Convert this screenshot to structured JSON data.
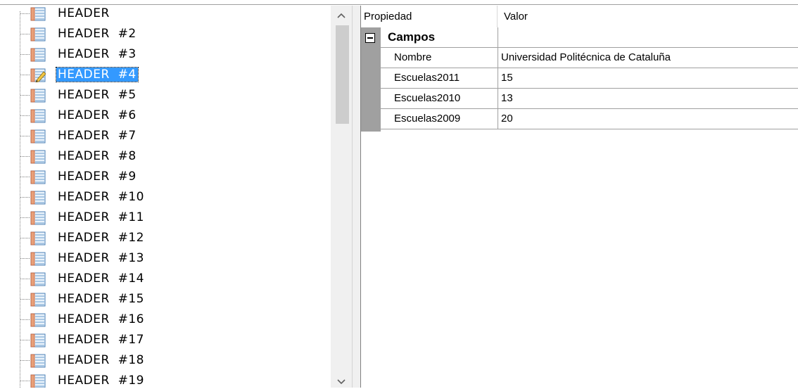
{
  "tree": {
    "selected_index": 3,
    "items": [
      {
        "label": "HEADER",
        "icon": "table-icon"
      },
      {
        "label": "HEADER  #2",
        "icon": "table-icon"
      },
      {
        "label": "HEADER  #3",
        "icon": "table-icon"
      },
      {
        "label": "HEADER  #4",
        "icon": "table-edit-icon"
      },
      {
        "label": "HEADER  #5",
        "icon": "table-icon"
      },
      {
        "label": "HEADER  #6",
        "icon": "table-icon"
      },
      {
        "label": "HEADER  #7",
        "icon": "table-icon"
      },
      {
        "label": "HEADER  #8",
        "icon": "table-icon"
      },
      {
        "label": "HEADER  #9",
        "icon": "table-icon"
      },
      {
        "label": "HEADER  #10",
        "icon": "table-icon"
      },
      {
        "label": "HEADER  #11",
        "icon": "table-icon"
      },
      {
        "label": "HEADER  #12",
        "icon": "table-icon"
      },
      {
        "label": "HEADER  #13",
        "icon": "table-icon"
      },
      {
        "label": "HEADER  #14",
        "icon": "table-icon"
      },
      {
        "label": "HEADER  #15",
        "icon": "table-icon"
      },
      {
        "label": "HEADER  #16",
        "icon": "table-icon"
      },
      {
        "label": "HEADER  #17",
        "icon": "table-icon"
      },
      {
        "label": "HEADER  #18",
        "icon": "table-icon"
      },
      {
        "label": "HEADER  #19",
        "icon": "table-icon"
      }
    ]
  },
  "scrollbar": {
    "up_icon": "chevron-up-icon",
    "down_icon": "chevron-down-icon"
  },
  "grid": {
    "header": {
      "property": "Propiedad",
      "value": "Valor"
    },
    "category": {
      "label": "Campos",
      "expanded": true
    },
    "rows": [
      {
        "name": "Nombre",
        "value": "Universidad Politécnica de Cataluña"
      },
      {
        "name": "Escuelas2011",
        "value": "15"
      },
      {
        "name": "Escuelas2010",
        "value": "13"
      },
      {
        "name": "Escuelas2009",
        "value": "20"
      }
    ]
  },
  "colors": {
    "selection": "#3399ff",
    "gutter": "#a0a0a0",
    "scrollbar": "#f0f0f0"
  }
}
